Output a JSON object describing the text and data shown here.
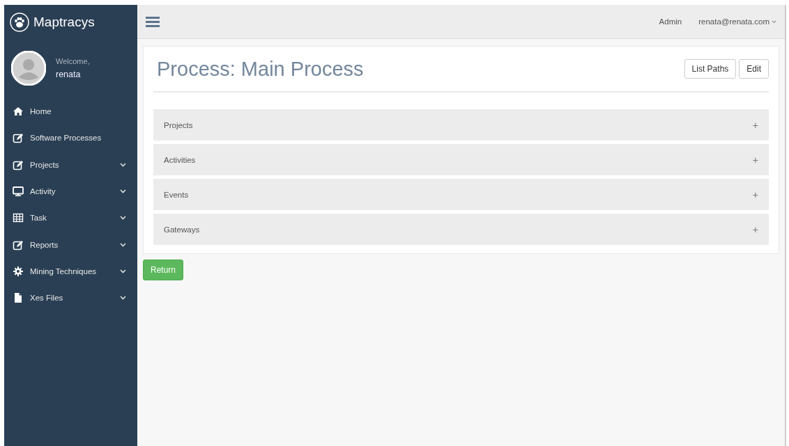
{
  "brand": {
    "name": "Maptracys"
  },
  "user": {
    "greeting": "Welcome,",
    "name": "renata"
  },
  "sidebar": {
    "items": [
      {
        "label": "Home",
        "kind": "home",
        "submenu": false
      },
      {
        "label": "Software Processes",
        "kind": "edit",
        "submenu": false
      },
      {
        "label": "Projects",
        "kind": "edit",
        "submenu": true
      },
      {
        "label": "Activity",
        "kind": "monitor",
        "submenu": true
      },
      {
        "label": "Task",
        "kind": "grid",
        "submenu": true
      },
      {
        "label": "Reports",
        "kind": "edit",
        "submenu": true
      },
      {
        "label": "Mining Techniques",
        "kind": "gear",
        "submenu": true
      },
      {
        "label": "Xes Files",
        "kind": "file",
        "submenu": true
      }
    ]
  },
  "topbar": {
    "role": "Admin",
    "account": "renata@renata.com"
  },
  "page": {
    "title": "Process: Main Process",
    "actions": [
      "List Paths",
      "Edit"
    ],
    "panels": [
      {
        "title": "Projects",
        "toggle": "+"
      },
      {
        "title": "Activities",
        "toggle": "+"
      },
      {
        "title": "Events",
        "toggle": "+"
      },
      {
        "title": "Gateways",
        "toggle": "+"
      }
    ],
    "return_button": "Return"
  }
}
